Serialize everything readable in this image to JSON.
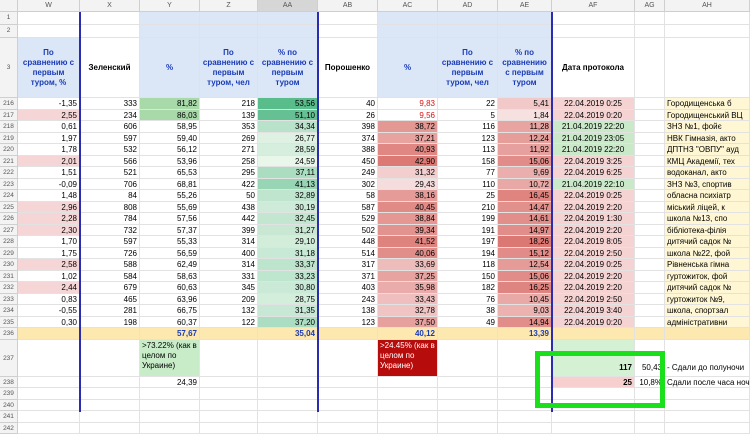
{
  "columns": [
    "W",
    "X",
    "Y",
    "Z",
    "AA",
    "AB",
    "AC",
    "AD",
    "AE",
    "AF",
    "AG",
    "AH"
  ],
  "top_rows": [
    "1",
    "2",
    "3"
  ],
  "headers": {
    "W": "По сравнению с первым туром, %",
    "X": "Зеленский",
    "Y": "%",
    "Z": "По сравнению с первым туром, чел",
    "AA": "% по сравнению с первым туром",
    "AB": "Порошенко",
    "AC": "%",
    "AD": "По сравнению с первым туром, чел",
    "AE": "% по сравнению с первым туром",
    "AF": "Дата протокола"
  },
  "rows": [
    {
      "n": "216",
      "w": "-1,35",
      "x": "333",
      "y": "81,82",
      "z": "218",
      "aa": "53,56",
      "ab": "40",
      "ac": "9,83",
      "ad": "22",
      "ae": "5,41",
      "af": "22.04.2019 0:25",
      "ah": "Городищенська б"
    },
    {
      "n": "217",
      "w": "2,55",
      "x": "234",
      "y": "86,03",
      "z": "139",
      "aa": "51,10",
      "ab": "26",
      "ac": "9,56",
      "ad": "5",
      "ae": "1,84",
      "af": "22.04.2019 0:20",
      "ah": "Городищенський ВЦ"
    },
    {
      "n": "218",
      "w": "0,61",
      "x": "606",
      "y": "58,95",
      "z": "353",
      "aa": "34,34",
      "ab": "398",
      "ac": "38,72",
      "ad": "116",
      "ae": "11,28",
      "af": "21.04.2019 22:20",
      "ah": "ЗНЗ №1, фойє"
    },
    {
      "n": "219",
      "w": "1,97",
      "x": "597",
      "y": "59,40",
      "z": "269",
      "aa": "26,77",
      "ab": "374",
      "ac": "37,21",
      "ad": "123",
      "ae": "12,24",
      "af": "21.04.2019 23:05",
      "ah": "НВК Гімназія, акто"
    },
    {
      "n": "220",
      "w": "1,78",
      "x": "532",
      "y": "56,12",
      "z": "271",
      "aa": "28,59",
      "ab": "388",
      "ac": "40,93",
      "ad": "113",
      "ae": "11,92",
      "af": "21.04.2019 22:20",
      "ah": "ДПТНЗ \"ОВПУ\" ауд"
    },
    {
      "n": "221",
      "w": "2,01",
      "x": "566",
      "y": "53,96",
      "z": "258",
      "aa": "24,59",
      "ab": "450",
      "ac": "42,90",
      "ad": "158",
      "ae": "15,06",
      "af": "22.04.2019 3:25",
      "ah": "КМЦ Академії, тех"
    },
    {
      "n": "222",
      "w": "1,51",
      "x": "521",
      "y": "65,53",
      "z": "295",
      "aa": "37,11",
      "ab": "249",
      "ac": "31,32",
      "ad": "77",
      "ae": "9,69",
      "af": "22.04.2019 6:25",
      "ah": "водоканал, акто"
    },
    {
      "n": "223",
      "w": "-0,09",
      "x": "706",
      "y": "68,81",
      "z": "422",
      "aa": "41,13",
      "ab": "302",
      "ac": "29,43",
      "ad": "110",
      "ae": "10,72",
      "af": "21.04.2019 22:10",
      "ah": "ЗНЗ №3, спортив"
    },
    {
      "n": "224",
      "w": "1,48",
      "x": "84",
      "y": "55,26",
      "z": "50",
      "aa": "32,89",
      "ab": "58",
      "ac": "38,16",
      "ad": "25",
      "ae": "16,45",
      "af": "22.04.2019 0:25",
      "ah": "обласна психіатр"
    },
    {
      "n": "225",
      "w": "2,96",
      "x": "808",
      "y": "55,69",
      "z": "438",
      "aa": "30,19",
      "ab": "587",
      "ac": "40,45",
      "ad": "210",
      "ae": "14,47",
      "af": "22.04.2019 2:20",
      "ah": "міський ліцей, к"
    },
    {
      "n": "226",
      "w": "2,28",
      "x": "784",
      "y": "57,56",
      "z": "442",
      "aa": "32,45",
      "ab": "529",
      "ac": "38,84",
      "ad": "199",
      "ae": "14,61",
      "af": "22.04.2019 1:30",
      "ah": "школа №13, спо"
    },
    {
      "n": "227",
      "w": "2,30",
      "x": "732",
      "y": "57,37",
      "z": "399",
      "aa": "31,27",
      "ab": "502",
      "ac": "39,34",
      "ad": "191",
      "ae": "14,97",
      "af": "22.04.2019 2:20",
      "ah": "бібліотека-філія"
    },
    {
      "n": "228",
      "w": "1,70",
      "x": "597",
      "y": "55,33",
      "z": "314",
      "aa": "29,10",
      "ab": "448",
      "ac": "41,52",
      "ad": "197",
      "ae": "18,26",
      "af": "22.04.2019 8:05",
      "ah": "дитячий садок №"
    },
    {
      "n": "229",
      "w": "1,75",
      "x": "726",
      "y": "56,59",
      "z": "400",
      "aa": "31,18",
      "ab": "514",
      "ac": "40,06",
      "ad": "194",
      "ae": "15,12",
      "af": "22.04.2019 2:50",
      "ah": "школа №22, фой"
    },
    {
      "n": "230",
      "w": "2,58",
      "x": "588",
      "y": "62,49",
      "z": "314",
      "aa": "33,37",
      "ab": "317",
      "ac": "33,69",
      "ad": "118",
      "ae": "12,54",
      "af": "22.04.2019 0:25",
      "ah": "Рівненська гімна"
    },
    {
      "n": "231",
      "w": "1,02",
      "x": "584",
      "y": "58,63",
      "z": "331",
      "aa": "33,23",
      "ab": "371",
      "ac": "37,25",
      "ad": "150",
      "ae": "15,06",
      "af": "22.04.2019 2:20",
      "ah": "гуртожиток, фой"
    },
    {
      "n": "232",
      "w": "2,44",
      "x": "679",
      "y": "60,63",
      "z": "345",
      "aa": "30,80",
      "ab": "403",
      "ac": "35,98",
      "ad": "182",
      "ae": "16,25",
      "af": "22.04.2019 2:20",
      "ah": "дитячий садок №"
    },
    {
      "n": "233",
      "w": "0,83",
      "x": "465",
      "y": "63,96",
      "z": "209",
      "aa": "28,75",
      "ab": "243",
      "ac": "33,43",
      "ad": "76",
      "ae": "10,45",
      "af": "22.04.2019 2:50",
      "ah": "гуртожиток №9,"
    },
    {
      "n": "234",
      "w": "-0,55",
      "x": "281",
      "y": "66,75",
      "z": "132",
      "aa": "31,35",
      "ab": "138",
      "ac": "32,78",
      "ad": "38",
      "ae": "9,03",
      "af": "22.04.2019 3:40",
      "ah": "школа, спортзал"
    },
    {
      "n": "235",
      "w": "0,30",
      "x": "198",
      "y": "60,37",
      "z": "122",
      "aa": "37,20",
      "ab": "123",
      "ac": "37,50",
      "ad": "49",
      "ae": "14,94",
      "af": "22.04.2019 0:20",
      "ah": "адміністративни"
    }
  ],
  "row236": {
    "n": "236",
    "y": "57,67",
    "aa": "35,04",
    "ac": "40,12",
    "ae": "13,39"
  },
  "row237": {
    "n": "237",
    "y_note": ">73.22% (как в целом по Украине)",
    "ac_note": ">24.45% (как в целом по Украине)",
    "af": "117",
    "ag": "50,43",
    "ah": "- Сдали до полуночи"
  },
  "row238": {
    "n": "238",
    "y": "24,39",
    "af": "25",
    "ag": "10,8%",
    "ah": "Сдали после часа ночи(!)"
  },
  "tail_rows": [
    "239",
    "240",
    "241",
    "242"
  ]
}
